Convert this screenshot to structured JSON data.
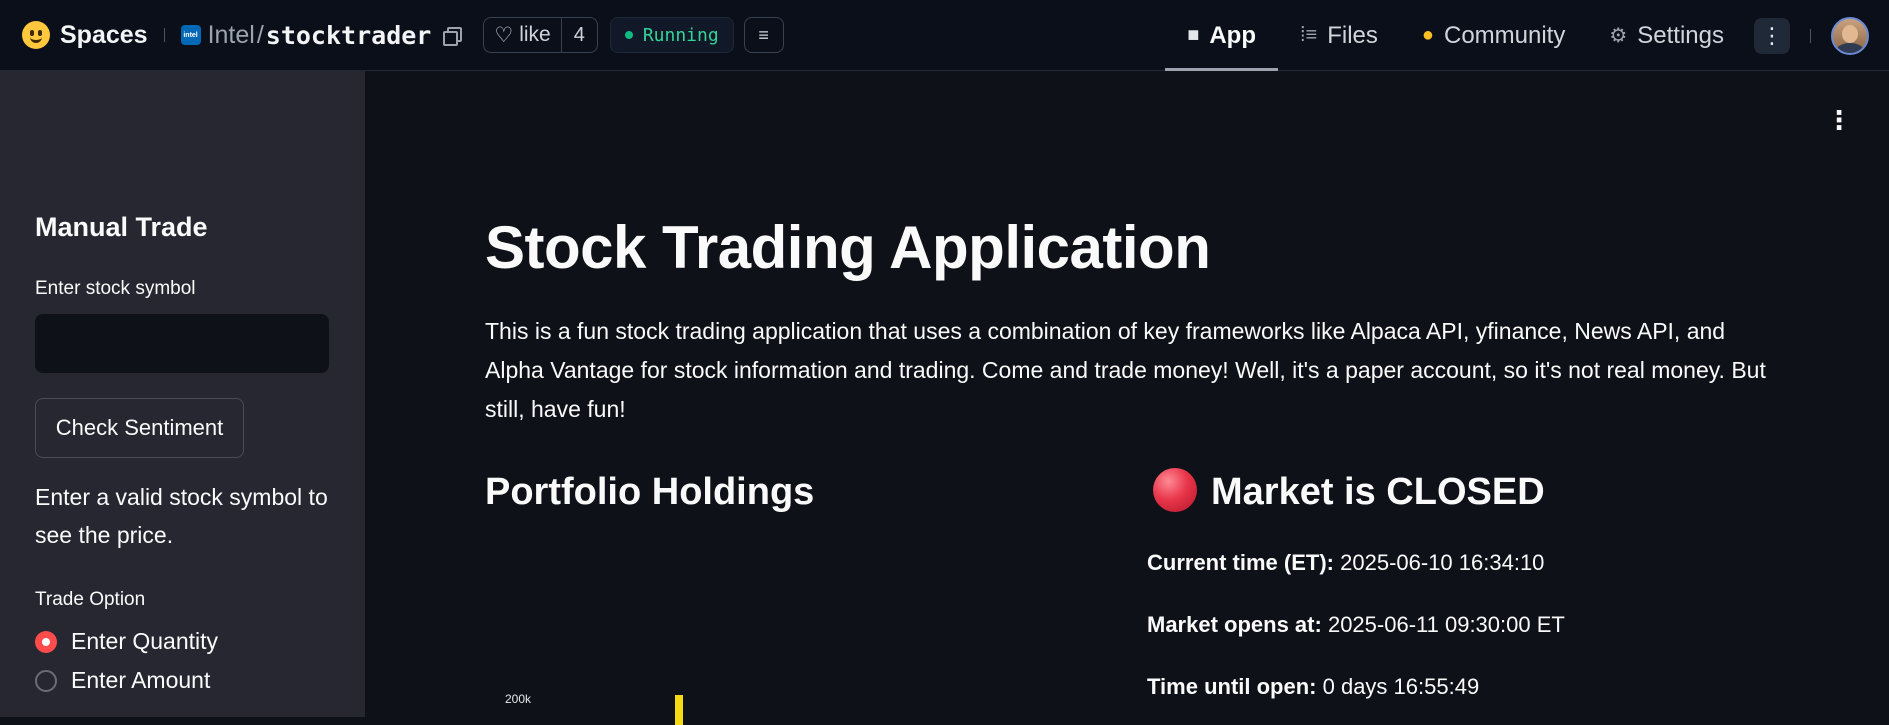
{
  "topbar": {
    "brand": "Spaces",
    "org_logo_text": "intel",
    "org": "Intel",
    "slash": "/",
    "repo": "stocktrader",
    "like_label": "like",
    "like_count": "4",
    "status": "Running",
    "nav": [
      {
        "label": "App",
        "icon": "cube-icon",
        "active": true
      },
      {
        "label": "Files",
        "icon": "files-icon",
        "active": false
      },
      {
        "label": "Community",
        "icon": "community-icon",
        "active": false
      },
      {
        "label": "Settings",
        "icon": "gear-icon",
        "active": false
      }
    ]
  },
  "sidebar": {
    "title": "Manual Trade",
    "symbol_label": "Enter stock symbol",
    "symbol_value": "",
    "check_button": "Check Sentiment",
    "help_text": "Enter a valid stock symbol to see the price.",
    "trade_option_label": "Trade Option",
    "options": [
      {
        "label": "Enter Quantity",
        "checked": true
      },
      {
        "label": "Enter Amount",
        "checked": false
      }
    ]
  },
  "main": {
    "title": "Stock Trading Application",
    "intro": "This is a fun stock trading application that uses a combination of key frameworks like Alpaca API, yfinance, News API, and Alpha Vantage for stock information and trading. Come and trade money! Well, it's a paper account, so it's not real money. But still, have fun!",
    "portfolio_heading": "Portfolio Holdings",
    "market_heading": "Market is CLOSED",
    "current_time_label": "Current time (ET):",
    "current_time_value": "2025-06-10 16:34:10",
    "opens_label": "Market opens at:",
    "opens_value": "2025-06-11 09:30:00 ET",
    "until_label": "Time until open:",
    "until_value": "0 days 16:55:49",
    "chart_tick": "200k"
  },
  "colors": {
    "accent": "#ff4b4b",
    "status_green": "#34d399",
    "sidebar_bg": "#262730",
    "main_bg": "#0e1117",
    "chart_bar": "#f5d915"
  }
}
